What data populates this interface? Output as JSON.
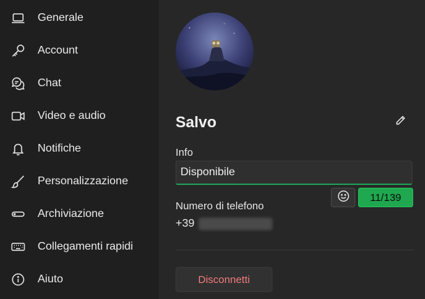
{
  "sidebar": {
    "items": [
      {
        "label": "Generale",
        "icon": "laptop-icon"
      },
      {
        "label": "Account",
        "icon": "key-icon"
      },
      {
        "label": "Chat",
        "icon": "chat-bubbles-icon"
      },
      {
        "label": "Video e audio",
        "icon": "video-camera-icon"
      },
      {
        "label": "Notifiche",
        "icon": "bell-icon"
      },
      {
        "label": "Personalizzazione",
        "icon": "paintbrush-icon"
      },
      {
        "label": "Archiviazione",
        "icon": "storage-icon"
      },
      {
        "label": "Collegamenti rapidi",
        "icon": "keyboard-icon"
      },
      {
        "label": "Aiuto",
        "icon": "info-icon"
      }
    ]
  },
  "profile": {
    "name": "Salvo",
    "info_label": "Info",
    "info_value": "Disponibile",
    "char_counter": "11/139",
    "phone_label": "Numero di telefono",
    "phone_prefix": "+39",
    "disconnect_label": "Disconnetti"
  },
  "colors": {
    "sidebar_bg": "#1f1f1f",
    "main_bg": "#272727",
    "accent_green": "#1fa84f",
    "danger_text": "#f07c7c"
  }
}
